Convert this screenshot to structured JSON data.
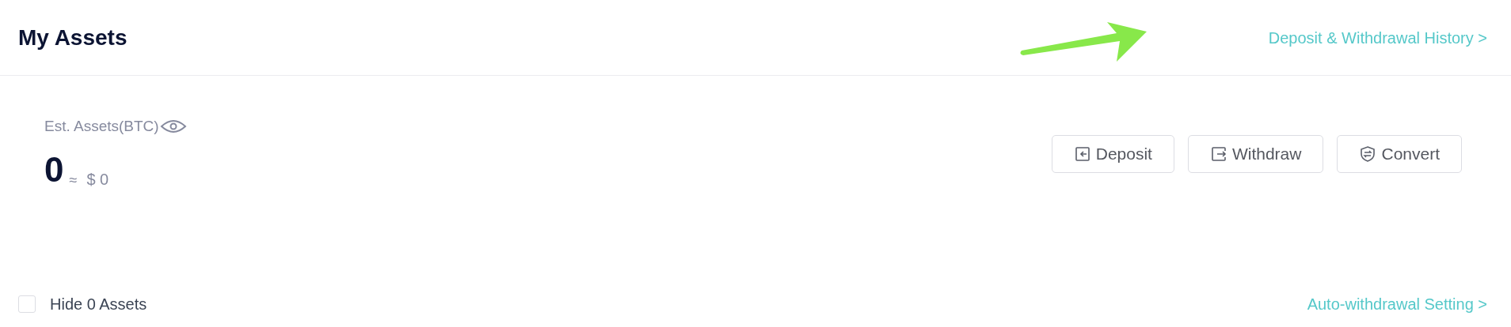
{
  "header": {
    "title": "My Assets",
    "history_link": "Deposit & Withdrawal History >"
  },
  "annotation": {
    "kind": "arrow"
  },
  "summary": {
    "label": "Est. Assets(BTC)",
    "amount": "0",
    "approx": "≈",
    "fiat": "$ 0"
  },
  "actions": [
    {
      "kind": "deposit",
      "label": "Deposit"
    },
    {
      "kind": "withdraw",
      "label": "Withdraw"
    },
    {
      "kind": "convert",
      "label": "Convert"
    }
  ],
  "footer": {
    "hide_zero": {
      "label": "Hide 0 Assets",
      "checked": false
    },
    "auto_link": "Auto-withdrawal Setting >"
  }
}
